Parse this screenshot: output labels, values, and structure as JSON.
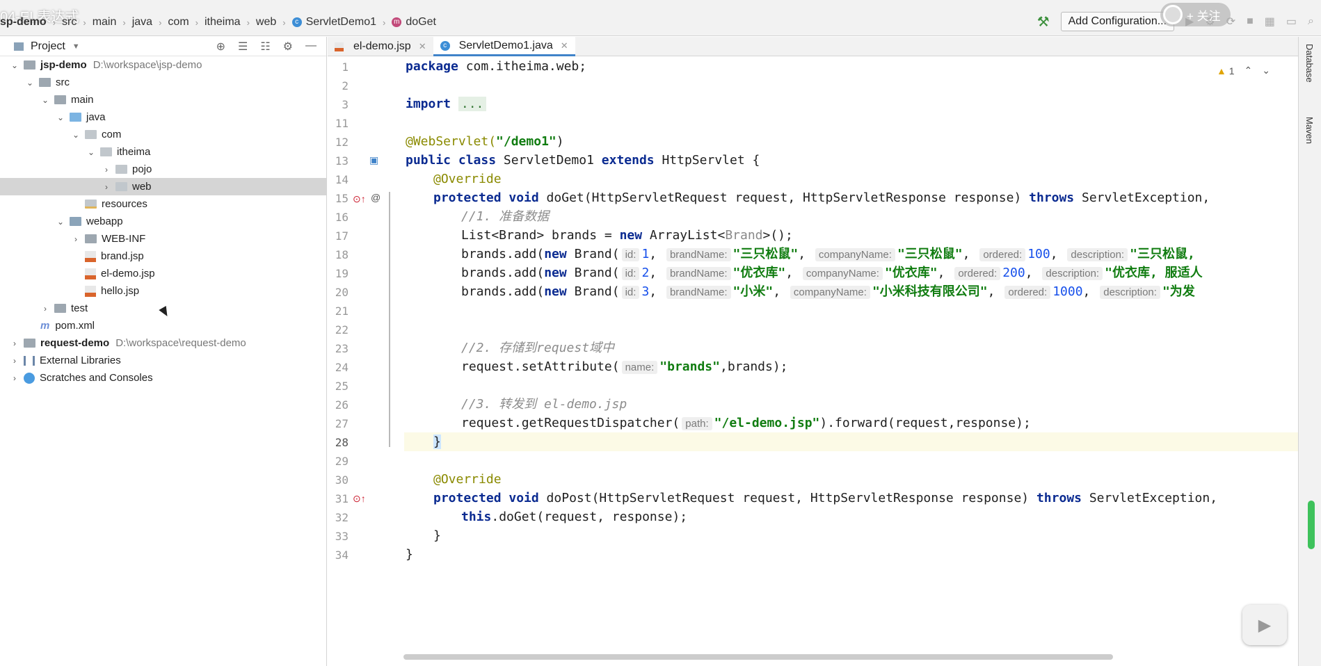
{
  "overlay_title": "04-EL表达式",
  "follow_label": "+ 关注",
  "breadcrumb": [
    "sp-demo",
    "src",
    "main",
    "java",
    "com",
    "itheima",
    "web",
    "ServletDemo1",
    "doGet"
  ],
  "toolbar": {
    "add_configuration": "Add Configuration..."
  },
  "sidebar": {
    "title": "Project",
    "tree": [
      {
        "label": "jsp-demo",
        "path": "D:\\workspace\\jsp-demo"
      },
      {
        "label": "src"
      },
      {
        "label": "main"
      },
      {
        "label": "java"
      },
      {
        "label": "com"
      },
      {
        "label": "itheima"
      },
      {
        "label": "pojo"
      },
      {
        "label": "web"
      },
      {
        "label": "resources"
      },
      {
        "label": "webapp"
      },
      {
        "label": "WEB-INF"
      },
      {
        "label": "brand.jsp"
      },
      {
        "label": "el-demo.jsp"
      },
      {
        "label": "hello.jsp"
      },
      {
        "label": "test"
      },
      {
        "label": "pom.xml"
      },
      {
        "label": "request-demo",
        "path": "D:\\workspace\\request-demo"
      },
      {
        "label": "External Libraries"
      },
      {
        "label": "Scratches and Consoles"
      }
    ]
  },
  "tabs": [
    {
      "label": "el-demo.jsp",
      "active": false
    },
    {
      "label": "ServletDemo1.java",
      "active": true
    }
  ],
  "warnings": {
    "count": "1"
  },
  "line_numbers": [
    "1",
    "2",
    "3",
    "11",
    "12",
    "13",
    "14",
    "15",
    "16",
    "17",
    "18",
    "19",
    "20",
    "21",
    "22",
    "23",
    "24",
    "25",
    "26",
    "27",
    "28",
    "29",
    "30",
    "31",
    "32",
    "33",
    "34"
  ],
  "code": {
    "l1_kw": "package",
    "l1_rest": " com.itheima.web;",
    "l3_kw": "import",
    "l3_fold": "...",
    "l12_ann": "@WebServlet(",
    "l12_str": "\"/demo1\"",
    "l12_end": ")",
    "l13_kw1": "public class",
    "l13_name": " ServletDemo1 ",
    "l13_kw2": "extends",
    "l13_rest": " HttpServlet {",
    "l14_ann": "@Override",
    "l15_kw": "protected void",
    "l15_rest": " doGet(HttpServletRequest request, HttpServletResponse response) ",
    "l15_kw2": "throws",
    "l15_end": " ServletException, ",
    "l16_cm": "//1. 准备数据",
    "l17_a": "List<Brand> brands = ",
    "l17_kw": "new",
    "l17_b": " ArrayList<",
    "l17_c": "Brand",
    "l17_d": ">();",
    "add_prefix": "brands.add(",
    "new_kw": "new",
    "brand_open": " Brand(",
    "hint_id": "id:",
    "hint_bn": "brandName:",
    "hint_cn": "companyName:",
    "hint_ord": "ordered:",
    "hint_desc": "description:",
    "l18": {
      "id": "1",
      "bn": "\"三只松鼠\"",
      "cn": "\"三只松鼠\"",
      "ord": "100",
      "desc": "\"三只松鼠,"
    },
    "l19": {
      "id": "2",
      "bn": "\"优衣库\"",
      "cn": "\"优衣库\"",
      "ord": "200",
      "desc": "\"优衣库, 服适人"
    },
    "l20": {
      "id": "3",
      "bn": "\"小米\"",
      "cn": "\"小米科技有限公司\"",
      "ord": "1000",
      "desc": "\"为发"
    },
    "comma": ", ",
    "l23_cm": "//2. 存储到request域中",
    "l24_a": "request.setAttribute(",
    "l24_hint": "name:",
    "l24_str": "\"brands\"",
    "l24_b": ",brands);",
    "l26_cm": "//3. 转发到 el-demo.jsp",
    "l27_a": "request.getRequestDispatcher(",
    "l27_hint": "path:",
    "l27_str": "\"/el-demo.jsp\"",
    "l27_b": ").forward(request,response);",
    "l28": "}",
    "l30_ann": "@Override",
    "l31_kw": "protected void",
    "l31_rest": " doPost(HttpServletRequest request, HttpServletResponse response) ",
    "l31_kw2": "throws",
    "l31_end": " ServletException,",
    "l32_kw": "this",
    "l32_rest": ".doGet(request, response);",
    "l33": "}",
    "l34": "}"
  },
  "right_tools": [
    "Database",
    "Maven"
  ]
}
